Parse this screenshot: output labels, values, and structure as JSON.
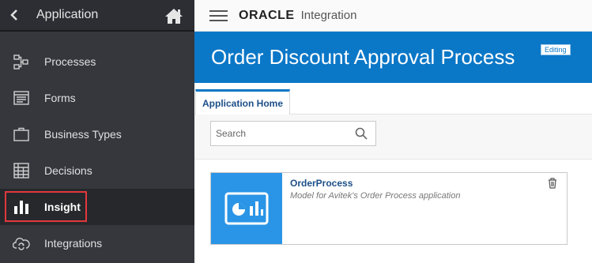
{
  "sidebar": {
    "title": "Application",
    "back_icon": "chevron-left-icon",
    "home_icon": "home-icon",
    "items": [
      {
        "label": "Processes",
        "icon": "process-flow-icon"
      },
      {
        "label": "Forms",
        "icon": "form-icon"
      },
      {
        "label": "Business Types",
        "icon": "briefcase-icon"
      },
      {
        "label": "Decisions",
        "icon": "grid-table-icon"
      },
      {
        "label": "Insight",
        "icon": "bar-chart-icon",
        "active": true
      },
      {
        "label": "Integrations",
        "icon": "cloud-sync-icon"
      }
    ]
  },
  "topbar": {
    "logo_text": "ORACLE",
    "product": "Integration"
  },
  "banner": {
    "title": "Order Discount Approval Process",
    "badge": "Editing"
  },
  "tabs": [
    {
      "label": "Application Home",
      "active": true
    }
  ],
  "search": {
    "placeholder": "Search",
    "value": ""
  },
  "cards": [
    {
      "name": "OrderProcess",
      "description": "Model for Avitek's Order Process application",
      "icon": "dashboard-icon",
      "delete_icon": "trash-icon"
    }
  ],
  "colors": {
    "sidebar_bg": "#35373d",
    "banner_bg": "#0b77c7",
    "thumb_bg": "#2a95e6",
    "highlight": "#e2383d",
    "link": "#1c4f88"
  }
}
